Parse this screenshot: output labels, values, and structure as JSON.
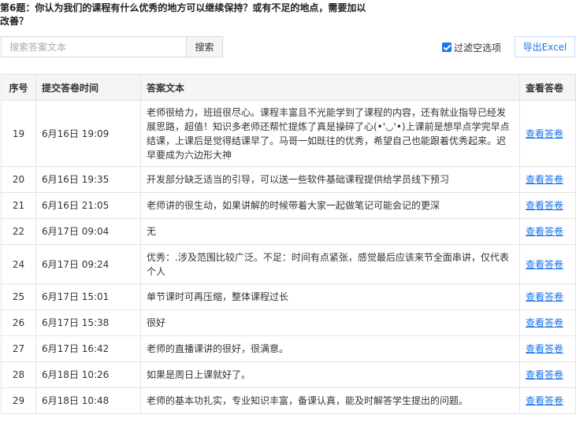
{
  "question": {
    "text": "第6题：你认为我们的课程有什么优秀的地方可以继续保持？或有不足的地点，需要加以改善？"
  },
  "toolbar": {
    "search_placeholder": "搜索答案文本",
    "search_button": "搜索",
    "filter_label": "过滤空选项",
    "filter_checked": true,
    "export_button": "导出Excel"
  },
  "table": {
    "headers": {
      "index": "序号",
      "time": "提交答卷时间",
      "answer": "答案文本",
      "view": "查看答卷"
    },
    "rows": [
      {
        "index": "19",
        "time": "6月16日 19:09",
        "answer": "老师很给力，班班很尽心。课程丰富且不光能学到了课程的内容，还有就业指导已经发展思路，超值！知识多老师还帮忙提炼了真是操碎了心(•'◡'•)上课前是想早点学完早点结课，上课后是觉得结课早了。马哥一如既往的优秀，希望自己也能跟着优秀起来。迟早要成为六边形大神",
        "link": "查看答卷"
      },
      {
        "index": "20",
        "time": "6月16日 19:35",
        "answer": "开发部分缺乏适当的引导，可以送一些软件基础课程提供给学员线下预习",
        "link": "查看答卷"
      },
      {
        "index": "21",
        "time": "6月16日 21:05",
        "answer": "老师讲的很生动，如果讲解的时候带着大家一起做笔记可能会记的更深",
        "link": "查看答卷"
      },
      {
        "index": "22",
        "time": "6月17日 09:04",
        "answer": "无",
        "link": "查看答卷"
      },
      {
        "index": "24",
        "time": "6月17日 09:24",
        "answer": "优秀：.涉及范围比较广泛。不足：时间有点紧张，感觉最后应该来节全面串讲，仅代表个人",
        "link": "查看答卷"
      },
      {
        "index": "25",
        "time": "6月17日 15:01",
        "answer": "单节课时可再压缩，整体课程过长",
        "link": "查看答卷"
      },
      {
        "index": "26",
        "time": "6月17日 15:38",
        "answer": "很好",
        "link": "查看答卷"
      },
      {
        "index": "27",
        "time": "6月17日 16:42",
        "answer": "老师的直播课讲的很好，很满意。",
        "link": "查看答卷"
      },
      {
        "index": "28",
        "time": "6月18日 10:26",
        "answer": "如果是周日上课就好了。",
        "link": "查看答卷"
      },
      {
        "index": "29",
        "time": "6月18日 10:48",
        "answer": "老师的基本功扎实，专业知识丰富，备课认真，能及时解答学生提出的问题。",
        "link": "查看答卷"
      }
    ]
  }
}
